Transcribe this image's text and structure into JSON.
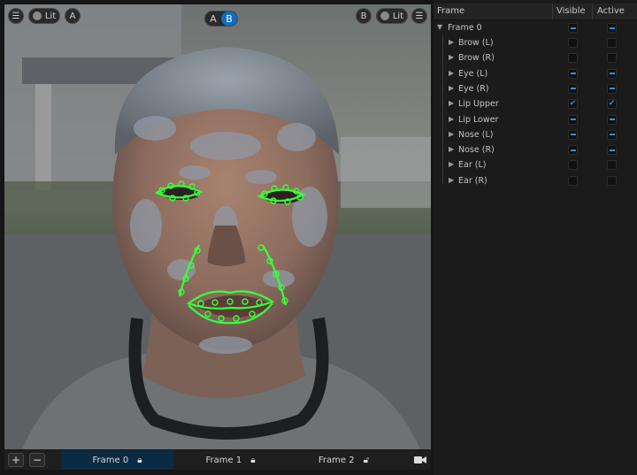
{
  "viewport": {
    "left_toolbar": {
      "menu_icon": "hamburger-icon",
      "lit_label": "Lit",
      "view_label": "A"
    },
    "ab_toggle": {
      "a": "A",
      "b": "B",
      "active": "B"
    },
    "right_toolbar": {
      "view_label": "B",
      "lit_label": "Lit",
      "menu_icon": "hamburger-icon"
    },
    "contour_color": "#39ff3a"
  },
  "bottombar": {
    "add_icon": "plus-icon",
    "remove_icon": "minus-icon",
    "frames": [
      {
        "label": "Frame 0",
        "lock": "locked",
        "active": true
      },
      {
        "label": "Frame 1",
        "lock": "locked",
        "active": false
      },
      {
        "label": "Frame 2",
        "lock": "unlocked",
        "active": false
      }
    ],
    "camera_icon": "camera-icon"
  },
  "panel": {
    "columns": {
      "frame": "Frame",
      "visible": "Visible",
      "active": "Active"
    },
    "root": {
      "label": "Frame 0",
      "visible": "partial",
      "active": "partial"
    },
    "items": [
      {
        "label": "Brow (L)",
        "visible": "off",
        "active": "off"
      },
      {
        "label": "Brow (R)",
        "visible": "off",
        "active": "off"
      },
      {
        "label": "Eye (L)",
        "visible": "partial",
        "active": "partial"
      },
      {
        "label": "Eye (R)",
        "visible": "partial",
        "active": "partial"
      },
      {
        "label": "Lip Upper",
        "visible": "on",
        "active": "on"
      },
      {
        "label": "Lip Lower",
        "visible": "partial",
        "active": "partial"
      },
      {
        "label": "Nose (L)",
        "visible": "partial",
        "active": "partial"
      },
      {
        "label": "Nose (R)",
        "visible": "partial",
        "active": "partial"
      },
      {
        "label": "Ear (L)",
        "visible": "off",
        "active": "off"
      },
      {
        "label": "Ear (R)",
        "visible": "off",
        "active": "off"
      }
    ],
    "accent_color": "#2f8ee8"
  }
}
